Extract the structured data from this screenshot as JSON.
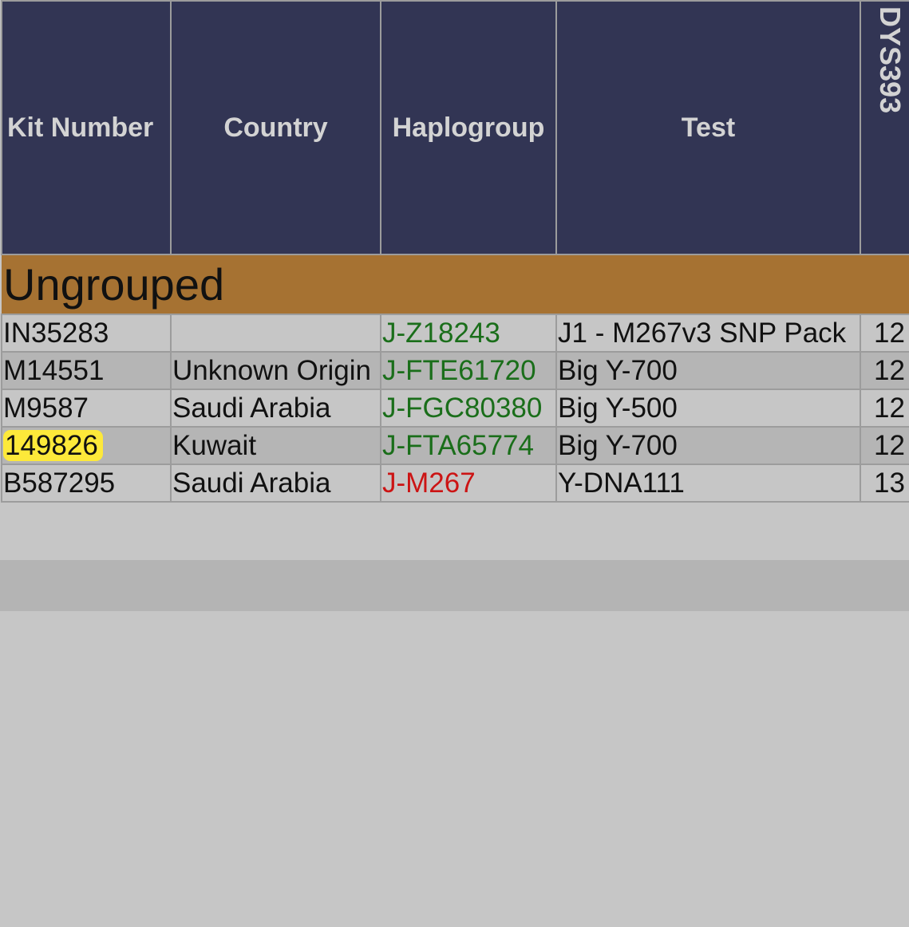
{
  "table": {
    "headers": {
      "kit": "Kit Number",
      "country": "Country",
      "haplogroup": "Haplogroup",
      "test": "Test",
      "dys": "DYS393"
    },
    "group_label": "Ungrouped",
    "rows": [
      {
        "kit": "IN35283",
        "country": "",
        "haplogroup": "J-Z18243",
        "haplo_color": "#1a6e1a",
        "test": "J1 - M267v3 SNP Pack",
        "dys": "12",
        "highlighted": false
      },
      {
        "kit": "M14551",
        "country": "Unknown Origin",
        "haplogroup": "J-FTE61720",
        "haplo_color": "#1a6e1a",
        "test": "Big Y-700",
        "dys": "12",
        "highlighted": false
      },
      {
        "kit": "M9587",
        "country": "Saudi Arabia",
        "haplogroup": "J-FGC80380",
        "haplo_color": "#1a6e1a",
        "test": "Big Y-500",
        "dys": "12",
        "highlighted": false
      },
      {
        "kit": "149826",
        "country": "Kuwait",
        "haplogroup": "J-FTA65774",
        "haplo_color": "#1a6e1a",
        "test": "Big Y-700",
        "dys": "12",
        "highlighted": true
      },
      {
        "kit": "B587295",
        "country": "Saudi Arabia",
        "haplogroup": "J-M267",
        "haplo_color": "#cc1414",
        "test": "Y-DNA111",
        "dys": "13",
        "highlighted": false
      }
    ]
  },
  "colors": {
    "header_bg": "#323554",
    "group_bg": "#a67232",
    "highlight": "#fde93a",
    "haplo_confirmed": "#1a6e1a",
    "haplo_predicted": "#cc1414"
  }
}
